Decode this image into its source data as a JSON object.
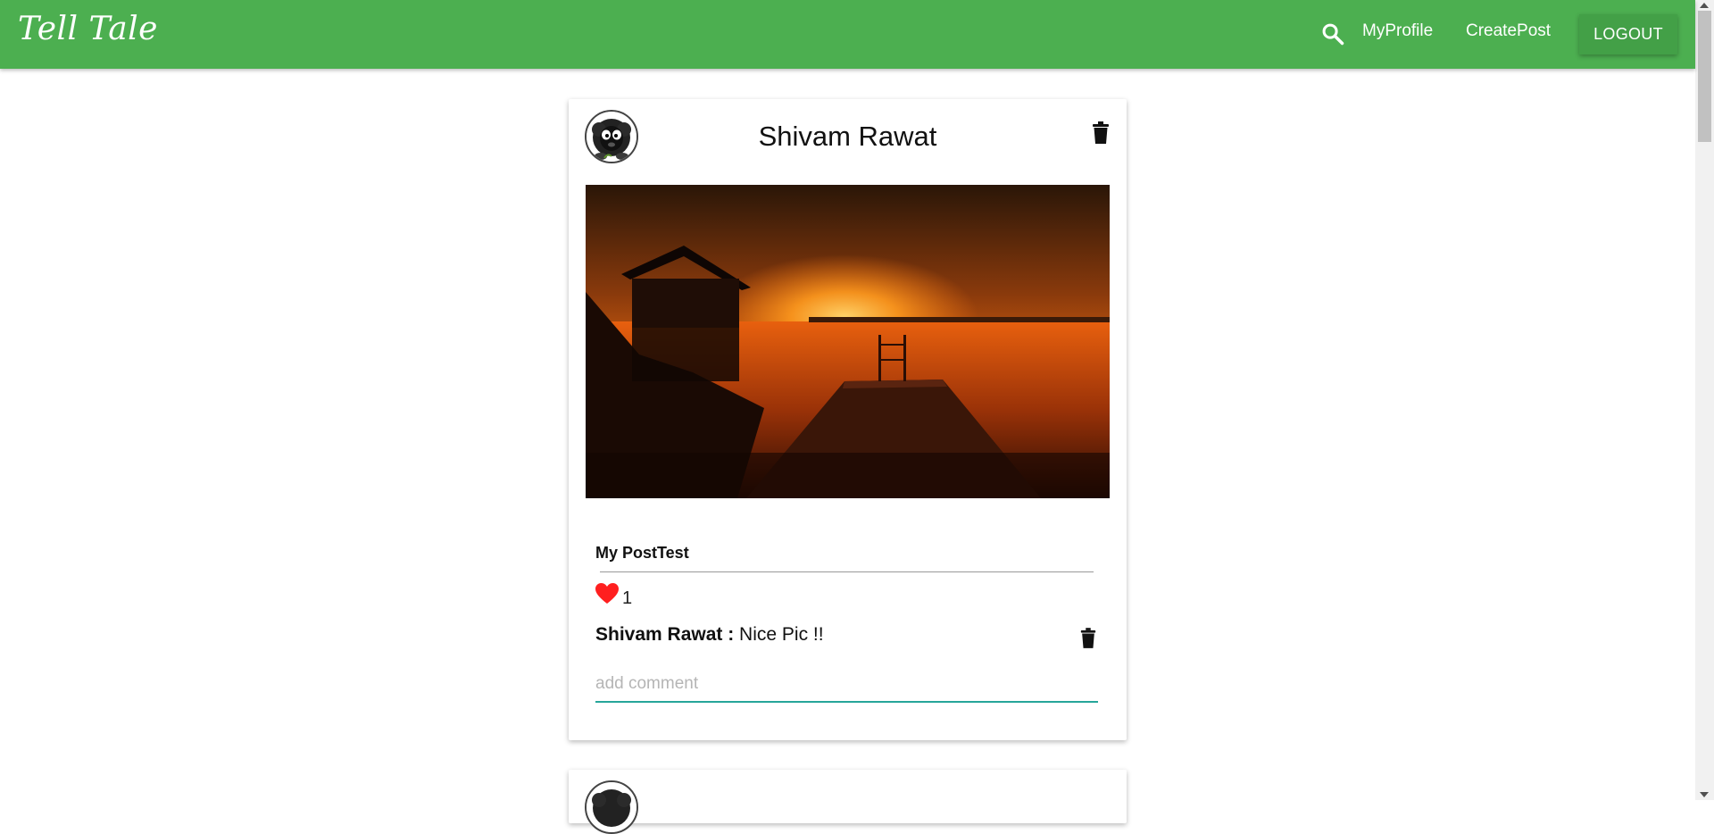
{
  "navbar": {
    "brand": "Tell Tale",
    "search_icon": "search-icon",
    "links": [
      "MyProfile",
      "CreatePost"
    ],
    "logout_label": "LOGOUT",
    "color": "#4caf50"
  },
  "posts": [
    {
      "author": "Shivam Rawat",
      "title": "My PostTest",
      "likes": "1",
      "image_desc_icon": "sunset-lake-pier-photo",
      "comments": [
        {
          "author": "Shivam Rawat :",
          "text": " Nice Pic !!"
        }
      ],
      "comment_placeholder": "add comment"
    }
  ],
  "icons": {
    "delete": "trash-icon",
    "like": "heart-icon",
    "avatar": "sheep-avatar-icon"
  },
  "colors": {
    "heart": "#ff1f1f",
    "input_underline": "#26a69a"
  }
}
